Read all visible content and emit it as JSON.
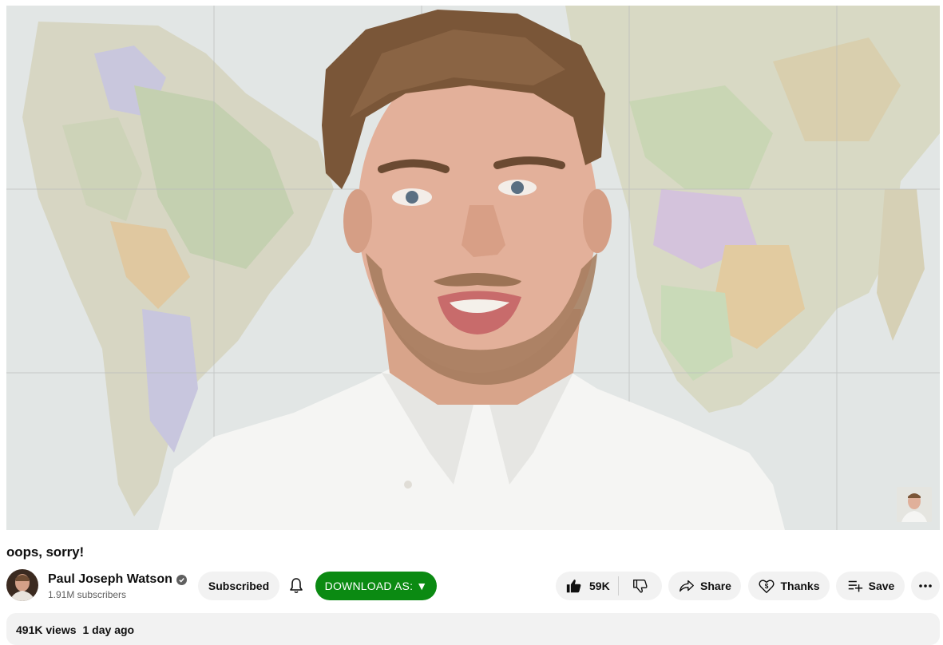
{
  "video": {
    "title": "oops, sorry!"
  },
  "channel": {
    "name": "Paul Joseph Watson",
    "subscribers": "1.91M subscribers",
    "verified_icon": "verified-check-icon"
  },
  "actions": {
    "subscribe_label": "Subscribed",
    "bell_icon": "bell-icon",
    "download_label": "DOWNLOAD AS: ▼",
    "like_count": "59K",
    "share_label": "Share",
    "thanks_label": "Thanks",
    "save_label": "Save",
    "more_icon": "more-horizontal-icon"
  },
  "description": {
    "views": "491K views",
    "age": "1 day ago"
  },
  "colors": {
    "download_bg": "#0b8a12",
    "pill_bg": "#f2f2f2",
    "text_secondary": "#606060"
  }
}
